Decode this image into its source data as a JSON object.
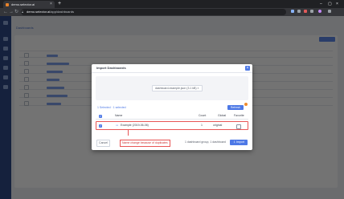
{
  "browser": {
    "tab_title": "demo.selector.ai",
    "tab_close": "×",
    "new_tab": "+",
    "url_host": "demo.selector.ai",
    "url_path": "/app/dashboards",
    "controls": {
      "minimize": "–",
      "maximize": "▢",
      "close": "×"
    },
    "nav": {
      "back": "←",
      "forward": "→",
      "reload": "↻"
    }
  },
  "app": {
    "page_title": "Dashboards"
  },
  "modal": {
    "title": "Import Dashboards",
    "close_icon": "×",
    "file_name": "dashboard-example.json (3.1 kB)  ×",
    "selection_info": "1 Selected · 1 selected",
    "refresh_label": "Refresh",
    "table": {
      "headers": {
        "check": "✓",
        "name": "Name",
        "count": "Count",
        "global": "Global",
        "favorite": "Favorite"
      },
      "rows": [
        {
          "check": "✓",
          "name": "Example (2019-06-06)",
          "count": "1",
          "global": "original"
        }
      ]
    },
    "annotation": "Name change because of duplicates",
    "cancel_label": "Cancel",
    "summary": "1 dashboard group, 1 dashboard",
    "import_label": "Import"
  },
  "colors": {
    "accent": "#4e79e6",
    "annotation": "#e85555",
    "sidebar": "#2f4a87"
  }
}
